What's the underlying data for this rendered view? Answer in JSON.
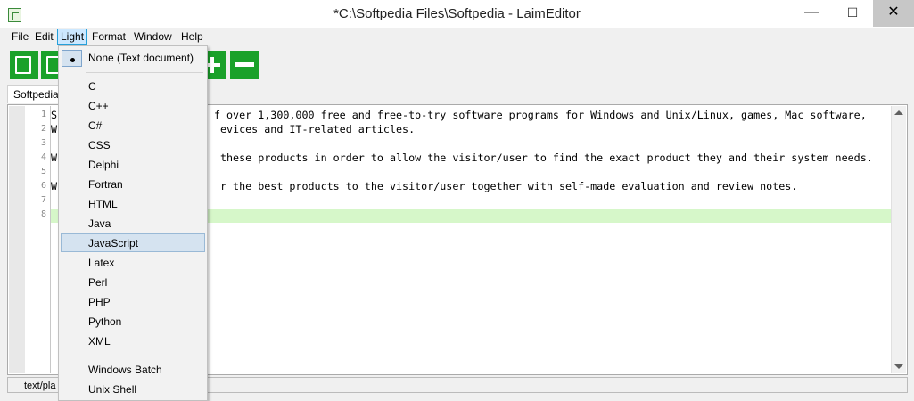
{
  "window": {
    "title": "*C:\\Softpedia Files\\Softpedia - LaimEditor",
    "minimize": "—",
    "maximize": "☐",
    "close": "✕"
  },
  "menu": {
    "items": [
      "File",
      "Edit",
      "Light",
      "Format",
      "Window",
      "Help"
    ]
  },
  "toolbar": {
    "buttons": [
      {
        "name": "new-document-icon"
      },
      {
        "name": "open-document-icon"
      },
      {
        "name": "add-icon"
      },
      {
        "name": "remove-icon"
      }
    ]
  },
  "tabs": {
    "active": "Softpedia"
  },
  "editor": {
    "line_numbers": [
      "1",
      "2",
      "3",
      "4",
      "5",
      "6",
      "7",
      "8"
    ],
    "lines": [
      "S                         f over 1,300,000 free and free-to-try software programs for Windows and Unix/Linux, games, Mac software,",
      "W                          evices and IT-related articles.",
      "",
      "W                          these products in order to allow the visitor/user to find the exact product they and their system needs.",
      "",
      "W                          r the best products to the visitor/user together with self-made evaluation and review notes.",
      "",
      ""
    ],
    "current_line": 8,
    "current_line_color": "#d6f7c9"
  },
  "status": {
    "text": "text/pla"
  },
  "light_menu": {
    "selected": "None (Text document)",
    "highlighted": "JavaScript",
    "items": [
      "None (Text document)",
      "C",
      "C++",
      "C#",
      "CSS",
      "Delphi",
      "Fortran",
      "HTML",
      "Java",
      "JavaScript",
      "Latex",
      "Perl",
      "PHP",
      "Python",
      "XML",
      "Windows Batch",
      "Unix Shell"
    ]
  },
  "colors": {
    "toolbar_green": "#1aa12a",
    "menu_highlight": "#cce8ff",
    "dropdown_highlight": "#d5e3f0"
  }
}
